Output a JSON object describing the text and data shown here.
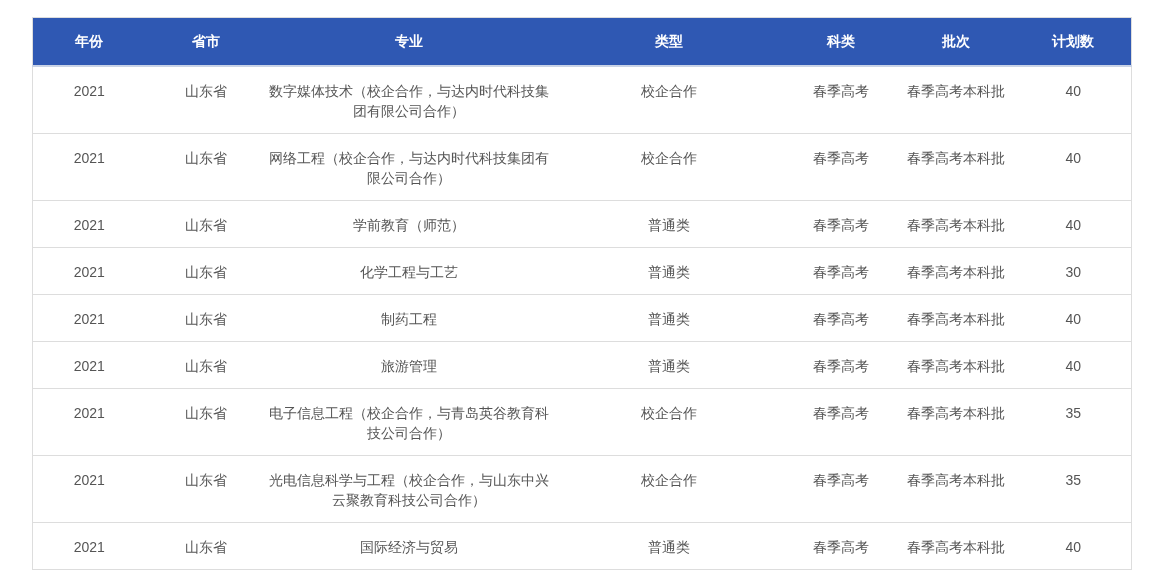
{
  "table": {
    "columns": [
      "年份",
      "省市",
      "专业",
      "类型",
      "科类",
      "批次",
      "计划数"
    ],
    "rows": [
      [
        "2021",
        "山东省",
        "数字媒体技术（校企合作，与达内时代科技集团有限公司合作）",
        "校企合作",
        "春季高考",
        "春季高考本科批",
        "40"
      ],
      [
        "2021",
        "山东省",
        "网络工程（校企合作，与达内时代科技集团有限公司合作）",
        "校企合作",
        "春季高考",
        "春季高考本科批",
        "40"
      ],
      [
        "2021",
        "山东省",
        "学前教育（师范）",
        "普通类",
        "春季高考",
        "春季高考本科批",
        "40"
      ],
      [
        "2021",
        "山东省",
        "化学工程与工艺",
        "普通类",
        "春季高考",
        "春季高考本科批",
        "30"
      ],
      [
        "2021",
        "山东省",
        "制药工程",
        "普通类",
        "春季高考",
        "春季高考本科批",
        "40"
      ],
      [
        "2021",
        "山东省",
        "旅游管理",
        "普通类",
        "春季高考",
        "春季高考本科批",
        "40"
      ],
      [
        "2021",
        "山东省",
        "电子信息工程（校企合作，与青岛英谷教育科技公司合作）",
        "校企合作",
        "春季高考",
        "春季高考本科批",
        "35"
      ],
      [
        "2021",
        "山东省",
        "光电信息科学与工程（校企合作，与山东中兴云聚教育科技公司合作）",
        "校企合作",
        "春季高考",
        "春季高考本科批",
        "35"
      ],
      [
        "2021",
        "山东省",
        "国际经济与贸易",
        "普通类",
        "春季高考",
        "春季高考本科批",
        "40"
      ]
    ]
  }
}
